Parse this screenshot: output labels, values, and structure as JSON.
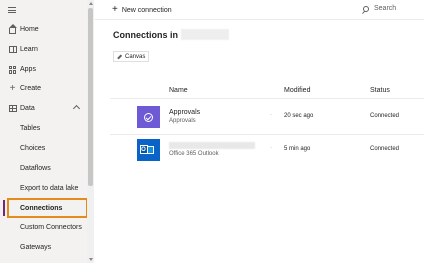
{
  "sidebar": {
    "items": [
      {
        "label": "Home",
        "icon": "home-icon"
      },
      {
        "label": "Learn",
        "icon": "book-icon"
      },
      {
        "label": "Apps",
        "icon": "apps-icon"
      },
      {
        "label": "Create",
        "icon": "plus-icon"
      },
      {
        "label": "Data",
        "icon": "table-icon",
        "expanded": true
      }
    ],
    "sub_items": [
      {
        "label": "Tables"
      },
      {
        "label": "Choices"
      },
      {
        "label": "Dataflows"
      },
      {
        "label": "Export to data lake"
      },
      {
        "label": "Connections",
        "selected": true
      },
      {
        "label": "Custom Connectors"
      },
      {
        "label": "Gateways"
      }
    ]
  },
  "topbar": {
    "new_connection_label": "New connection",
    "search_label": "Search"
  },
  "main": {
    "title": "Connections in",
    "filter_chip": "Canvas",
    "columns": {
      "name": "Name",
      "modified": "Modified",
      "status": "Status"
    },
    "rows": [
      {
        "name": "Approvals",
        "subtitle": "Approvals",
        "modified": "20 sec ago",
        "status": "Connected",
        "icon": "approvals-icon",
        "tile_color": "#6f5ad6"
      },
      {
        "name": "",
        "subtitle": "Office 365 Outlook",
        "modified": "5 min ago",
        "status": "Connected",
        "icon": "outlook-icon",
        "tile_color": "#0a64c8"
      }
    ]
  },
  "colors": {
    "selected_accent": "#742774",
    "highlight_box": "#e48b1c"
  }
}
